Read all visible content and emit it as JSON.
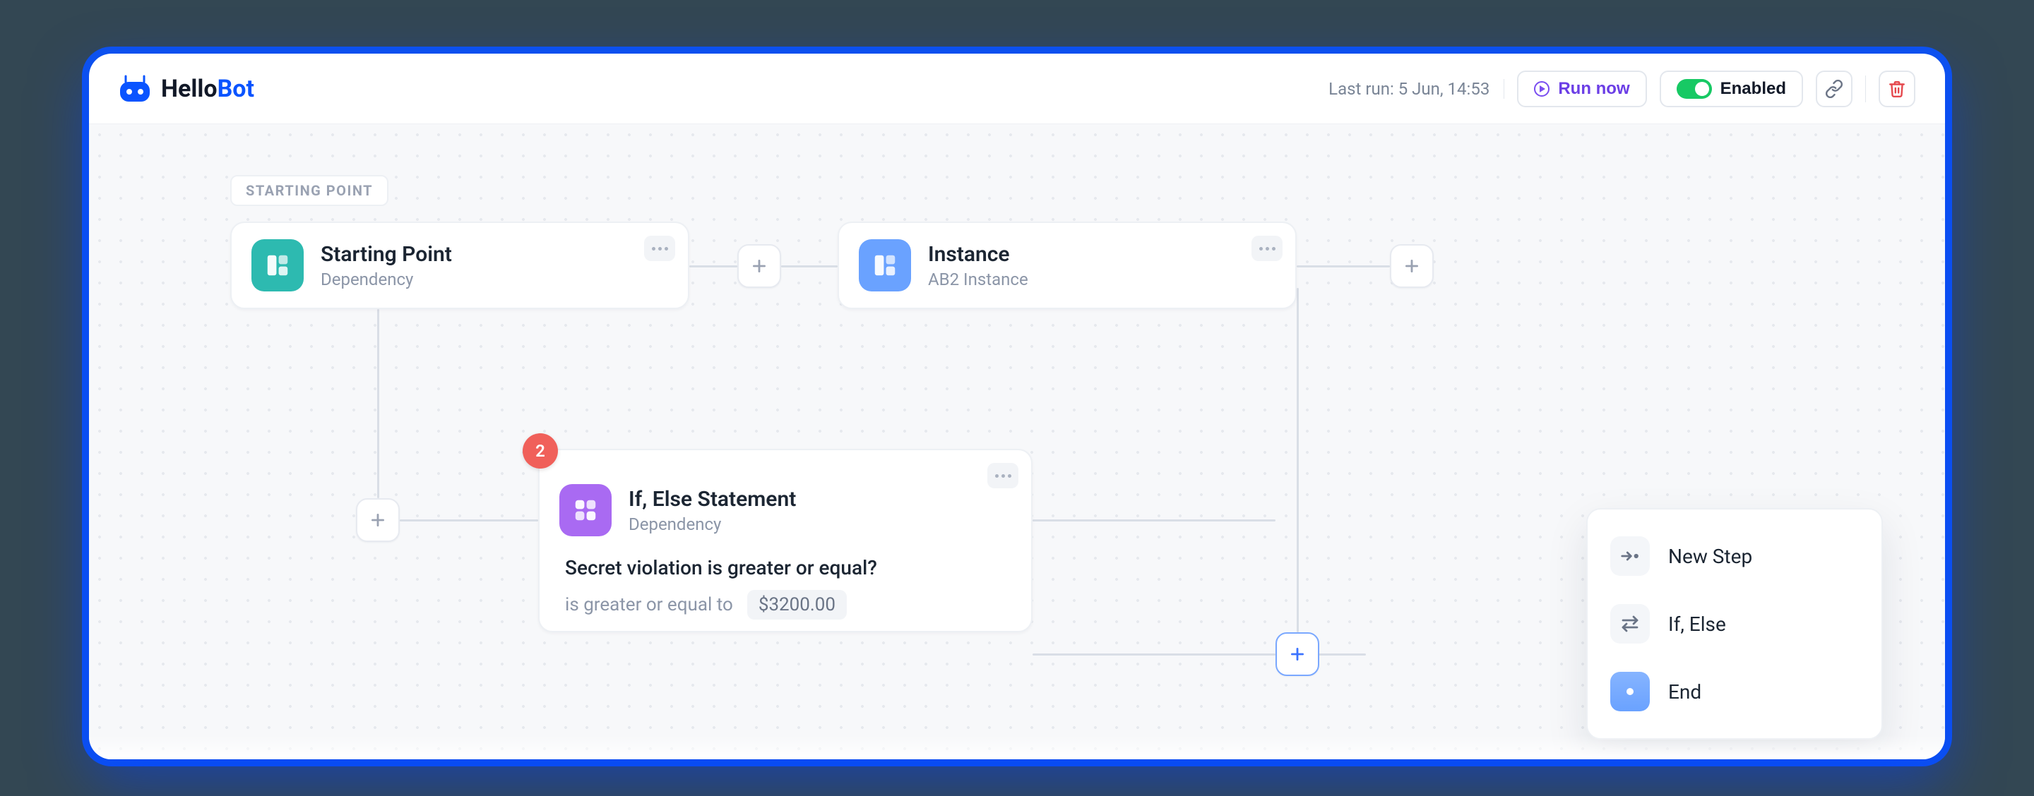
{
  "brand": {
    "first": "Hello",
    "second": "Bot"
  },
  "header": {
    "last_run_label": "Last run: 5 Jun, 14:53",
    "run_now": "Run now",
    "enabled": "Enabled"
  },
  "tag": "STARTING POINT",
  "nodes": {
    "start": {
      "title": "Starting Point",
      "subtitle": "Dependency"
    },
    "instance": {
      "title": "Instance",
      "subtitle": "AB2 Instance"
    },
    "ifelse": {
      "title": "If, Else Statement",
      "subtitle": "Dependency",
      "badge": "2",
      "question": "Secret violation is greater or equal?",
      "operator": "is greater or equal to",
      "value": "$3200.00"
    }
  },
  "menu": {
    "items": [
      {
        "label": "New Step"
      },
      {
        "label": "If, Else"
      },
      {
        "label": "End"
      }
    ]
  }
}
